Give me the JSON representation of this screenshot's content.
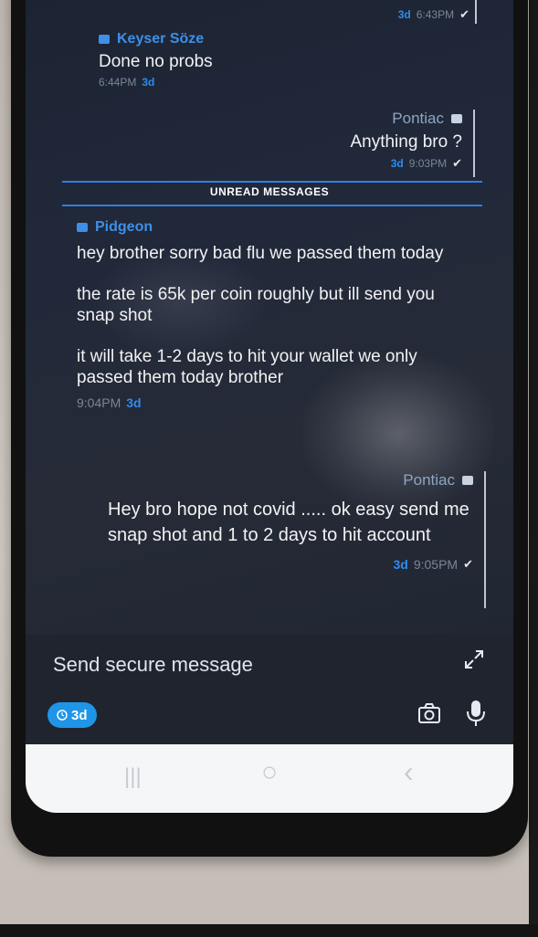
{
  "messages": [
    {
      "id": "m0",
      "direction": "outgoing",
      "sender": "",
      "text": "",
      "ttl": "3d",
      "time": "6:43PM",
      "status": "sent"
    },
    {
      "id": "m1",
      "direction": "incoming",
      "sender": "Keyser Söze",
      "text": "Done no probs",
      "time": "6:44PM",
      "ttl": "3d"
    },
    {
      "id": "m2",
      "direction": "outgoing",
      "sender": "Pontiac",
      "text": "Anything bro ?",
      "ttl": "3d",
      "time": "9:03PM",
      "status": "sent"
    }
  ],
  "unread_label": "UNREAD MESSAGES",
  "unread_messages": [
    {
      "id": "m3",
      "direction": "incoming",
      "sender": "Pidgeon",
      "paragraphs": [
        "hey brother sorry bad flu we passed them today",
        "the rate is 65k per coin roughly but ill send you snap shot",
        "it will take 1-2 days to hit your wallet we only passed them today brother"
      ],
      "time": "9:04PM",
      "ttl": "3d"
    },
    {
      "id": "m4",
      "direction": "outgoing",
      "sender": "Pontiac",
      "text": "Hey bro hope not covid ..... ok easy send me snap shot and 1 to 2 days to hit account",
      "ttl": "3d",
      "time": "9:05PM",
      "status": "sent"
    }
  ],
  "composer": {
    "placeholder": "Send secure message",
    "timer_label": "3d"
  },
  "icons": {
    "expand": "expand-icon",
    "camera": "camera-icon",
    "mic": "microphone-icon",
    "timer": "timer-icon",
    "check": "check-icon"
  },
  "colors": {
    "accent": "#2d8cf0",
    "sender_incoming": "#3f8fe8",
    "background": "#20283a"
  },
  "navbar": {
    "recents": "|||",
    "home": "○",
    "back": "‹"
  }
}
